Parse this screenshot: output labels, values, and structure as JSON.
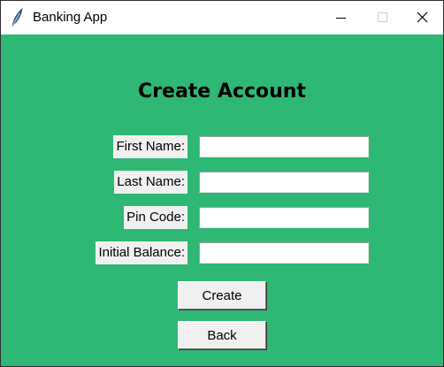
{
  "window": {
    "title": "Banking App",
    "icon": "feather-icon"
  },
  "titlebar_controls": {
    "minimize_icon": "minimize-icon",
    "maximize_icon": "maximize-icon",
    "close_icon": "close-icon"
  },
  "colors": {
    "background": "#2fb775",
    "label_background": "#f0f0f0",
    "button_background": "#f0f0f0"
  },
  "form": {
    "heading": "Create Account",
    "fields": [
      {
        "label": "First Name:",
        "value": ""
      },
      {
        "label": "Last Name:",
        "value": ""
      },
      {
        "label": "Pin Code:",
        "value": ""
      },
      {
        "label": "Initial Balance:",
        "value": ""
      }
    ],
    "create_label": "Create",
    "back_label": "Back"
  }
}
